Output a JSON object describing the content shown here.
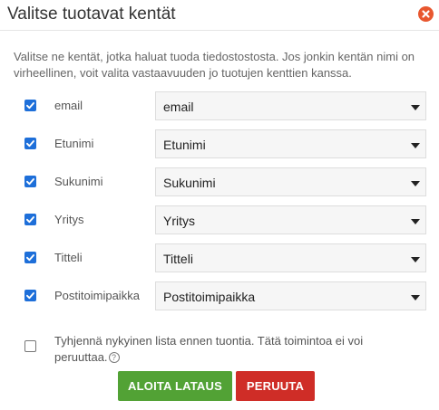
{
  "dialog": {
    "title": "Valitse tuotavat kentät",
    "description": "Valitse ne kentät, jotka haluat tuoda tiedostostosta. Jos jonkin kentän nimi on virheellinen, voit valita vastaavuuden jo tuotujen kenttien kanssa."
  },
  "fields": [
    {
      "label": "email",
      "selected": "email",
      "checked": true
    },
    {
      "label": "Etunimi",
      "selected": "Etunimi",
      "checked": true
    },
    {
      "label": "Sukunimi",
      "selected": "Sukunimi",
      "checked": true
    },
    {
      "label": "Yritys",
      "selected": "Yritys",
      "checked": true
    },
    {
      "label": "Titteli",
      "selected": "Titteli",
      "checked": true
    },
    {
      "label": "Postitoimipaikka",
      "selected": "Postitoimipaikka",
      "checked": true
    }
  ],
  "clear_list": {
    "text": "Tyhjennä nykyinen lista ennen tuontia. Tätä toimintoa ei voi peruuttaa.",
    "checked": false,
    "help_glyph": "?"
  },
  "buttons": {
    "start_label": "ALOITA LATAUS",
    "cancel_label": "PERUUTA"
  },
  "colors": {
    "accent_checkbox": "#1e6fd9",
    "start_button": "#52a235",
    "cancel_button": "#cf2d27",
    "close_button": "#e8572f"
  },
  "icons": {
    "close": "close-icon",
    "caret": "caret-down-icon",
    "check": "checkmark-icon",
    "help": "help-icon"
  }
}
